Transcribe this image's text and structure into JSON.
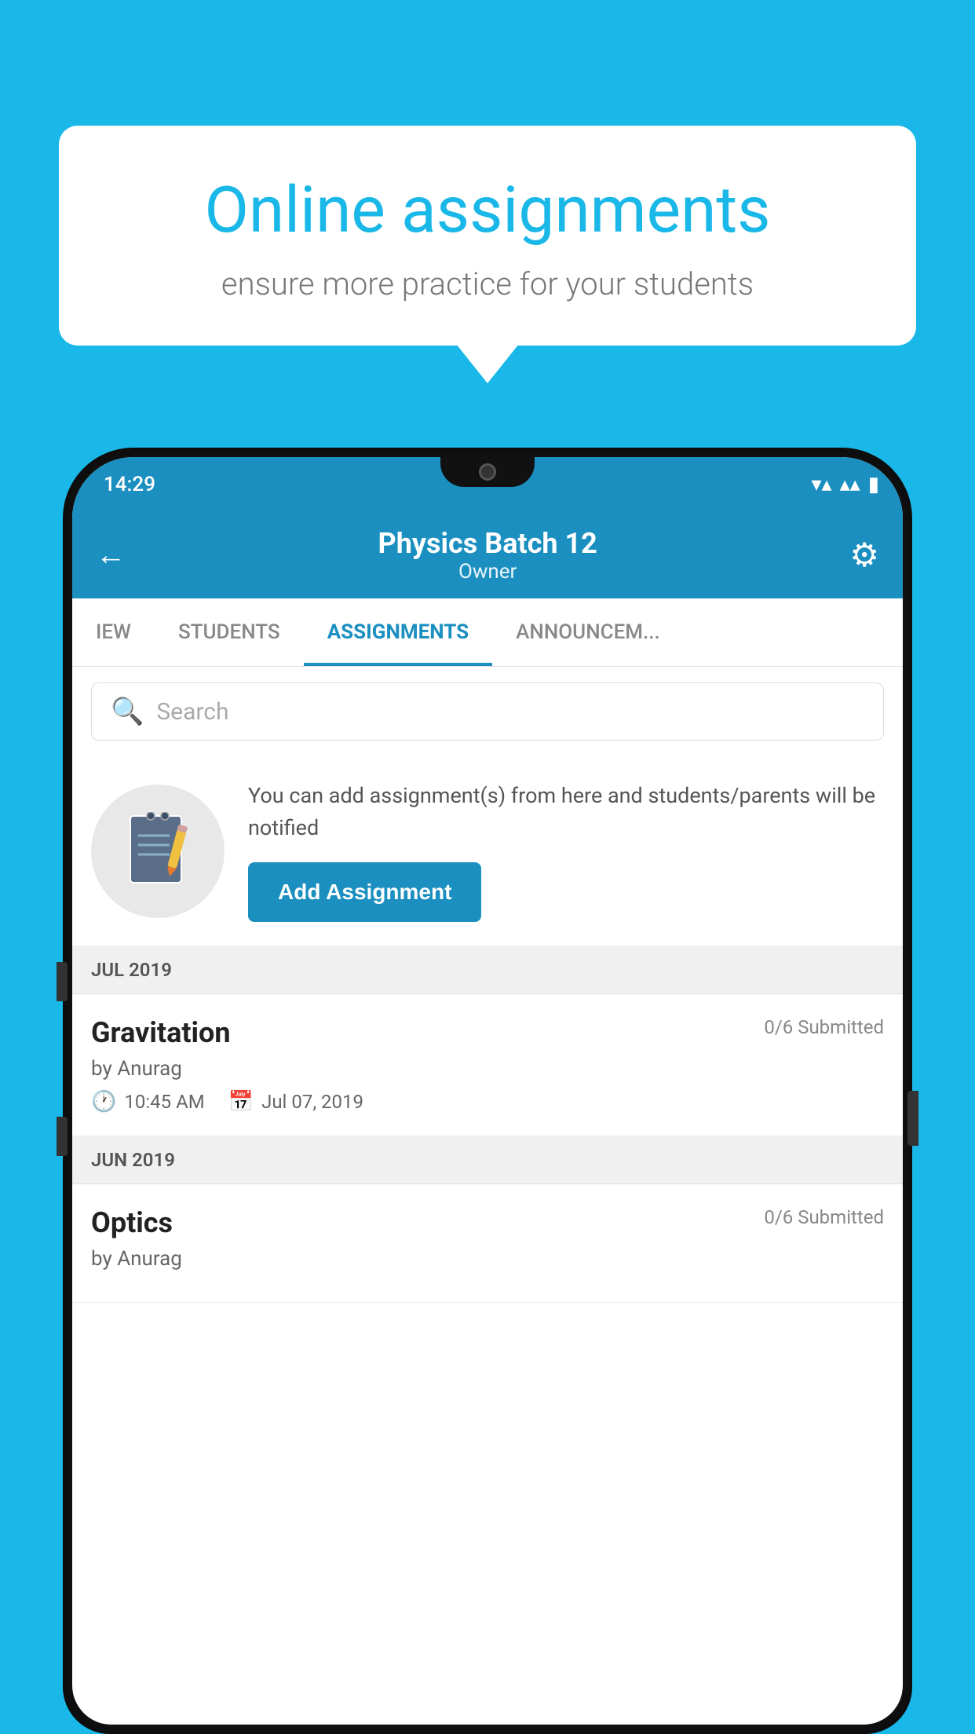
{
  "background_color": "#1ab8e8",
  "speech_bubble": {
    "title": "Online assignments",
    "subtitle": "ensure more practice for your students"
  },
  "status_bar": {
    "time": "14:29",
    "wifi": "▾",
    "signal": "▴▴",
    "battery": "▮"
  },
  "header": {
    "title": "Physics Batch 12",
    "subtitle": "Owner",
    "back_icon": "←",
    "settings_icon": "⚙"
  },
  "tabs": [
    {
      "label": "IEW",
      "active": false
    },
    {
      "label": "STUDENTS",
      "active": false
    },
    {
      "label": "ASSIGNMENTS",
      "active": true
    },
    {
      "label": "ANNOUNCEM...",
      "active": false
    }
  ],
  "search": {
    "placeholder": "Search"
  },
  "promo": {
    "text": "You can add assignment(s) from here and students/parents will be notified",
    "button_label": "Add Assignment"
  },
  "sections": [
    {
      "label": "JUL 2019",
      "assignments": [
        {
          "title": "Gravitation",
          "submitted": "0/6 Submitted",
          "by": "by Anurag",
          "time": "10:45 AM",
          "date": "Jul 07, 2019"
        }
      ]
    },
    {
      "label": "JUN 2019",
      "assignments": [
        {
          "title": "Optics",
          "submitted": "0/6 Submitted",
          "by": "by Anurag",
          "time": "",
          "date": ""
        }
      ]
    }
  ]
}
